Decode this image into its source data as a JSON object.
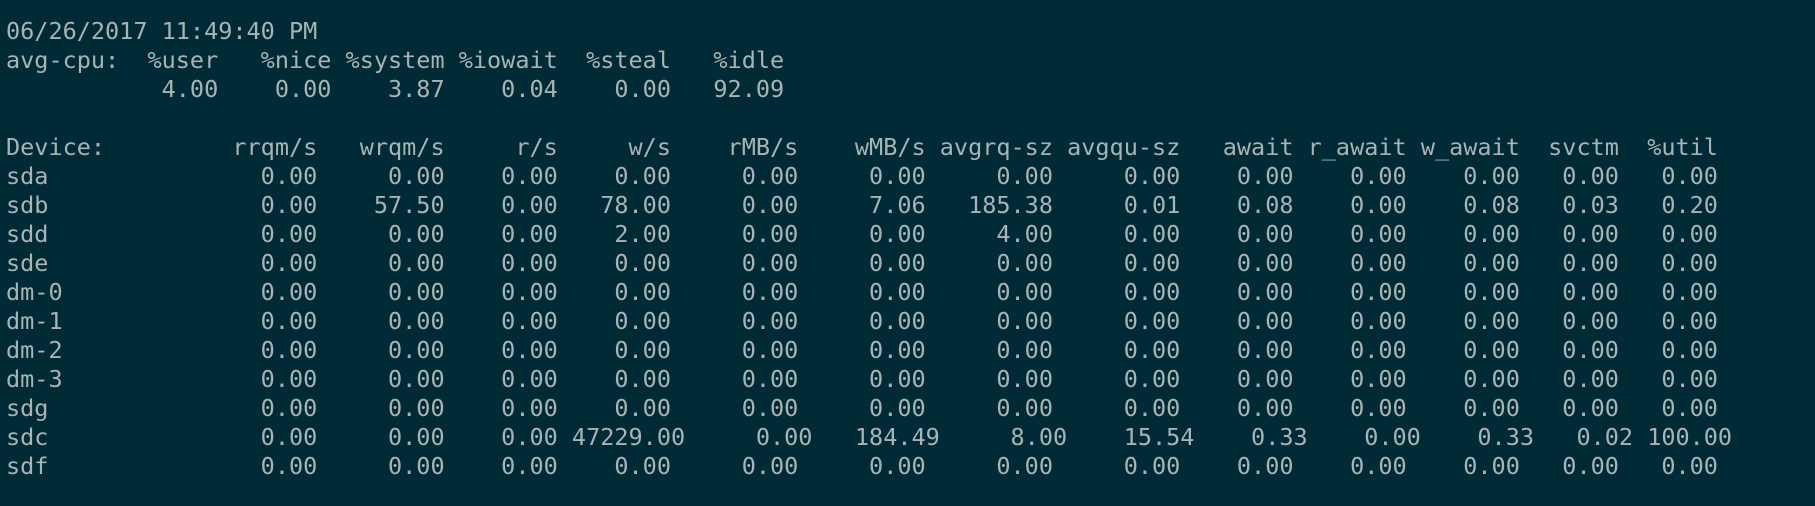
{
  "terminal": {
    "lines": [
      "06/26/2017 11:49:40 PM",
      "avg-cpu:  %user   %nice %system %iowait  %steal   %idle",
      "           4.00    0.00    3.87    0.04    0.00   92.09",
      "",
      "Device:         rrqm/s   wrqm/s     r/s     w/s    rMB/s    wMB/s avgrq-sz avgqu-sz   await r_await w_await  svctm  %util",
      "sda               0.00     0.00    0.00    0.00     0.00     0.00     0.00     0.00    0.00    0.00    0.00   0.00   0.00",
      "sdb               0.00    57.50    0.00   78.00     0.00     7.06   185.38     0.01    0.08    0.00    0.08   0.03   0.20",
      "sdd               0.00     0.00    0.00    2.00     0.00     0.00     4.00     0.00    0.00    0.00    0.00   0.00   0.00",
      "sde               0.00     0.00    0.00    0.00     0.00     0.00     0.00     0.00    0.00    0.00    0.00   0.00   0.00",
      "dm-0              0.00     0.00    0.00    0.00     0.00     0.00     0.00     0.00    0.00    0.00    0.00   0.00   0.00",
      "dm-1              0.00     0.00    0.00    0.00     0.00     0.00     0.00     0.00    0.00    0.00    0.00   0.00   0.00",
      "dm-2              0.00     0.00    0.00    0.00     0.00     0.00     0.00     0.00    0.00    0.00    0.00   0.00   0.00",
      "dm-3              0.00     0.00    0.00    0.00     0.00     0.00     0.00     0.00    0.00    0.00    0.00   0.00   0.00",
      "sdg               0.00     0.00    0.00    0.00     0.00     0.00     0.00     0.00    0.00    0.00    0.00   0.00   0.00",
      "sdc               0.00     0.00    0.00 47229.00     0.00   184.49     8.00    15.54    0.33    0.00    0.33   0.02 100.00",
      "sdf               0.00     0.00    0.00    0.00     0.00     0.00     0.00     0.00    0.00    0.00    0.00   0.00   0.00"
    ]
  },
  "colors": {
    "background": "#002b36",
    "foreground": "#a7b3b5"
  }
}
